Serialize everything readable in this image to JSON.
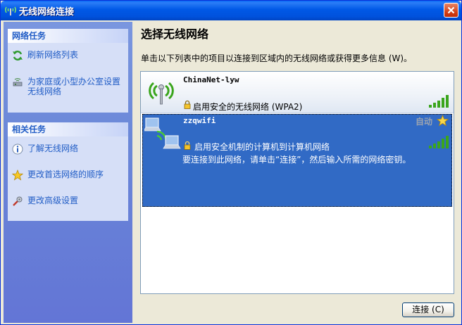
{
  "window": {
    "title": "无线网络连接",
    "close_icon": "close-icon"
  },
  "sidebar": {
    "network_tasks": {
      "heading": "网络任务",
      "items": [
        {
          "label": "刷新网络列表",
          "icon": "refresh-icon"
        },
        {
          "label": "为家庭或小型办公室设置无线网络",
          "icon": "wireless-setup-icon"
        }
      ]
    },
    "related_tasks": {
      "heading": "相关任务",
      "items": [
        {
          "label": "了解无线网络",
          "icon": "info-icon"
        },
        {
          "label": "更改首选网络的顺序",
          "icon": "star-icon"
        },
        {
          "label": "更改高级设置",
          "icon": "settings-icon"
        }
      ]
    }
  },
  "main": {
    "heading": "选择无线网络",
    "instruction": "单击以下列表中的项目以连接到区域内的无线网络或获得更多信息 (W)。",
    "networks": [
      {
        "ssid": "ChinaNet-lyw",
        "security": "启用安全的无线网络 (WPA2)",
        "signal_strength": 5,
        "selected": false
      },
      {
        "ssid": "zzqwifi",
        "security": "启用安全机制的计算机到计算机网络",
        "status": "自动",
        "note": "要连接到此网络，请单击“连接”，然后输入所需的网络密钥。",
        "signal_strength": 5,
        "selected": true
      }
    ],
    "connect_button": "连接 (C)"
  },
  "colors": {
    "title_blue": "#0058e6",
    "selection": "#316ac5",
    "sidebar": "#6a87d8",
    "task_text": "#215dc6",
    "signal_green": "#3aa51c"
  }
}
